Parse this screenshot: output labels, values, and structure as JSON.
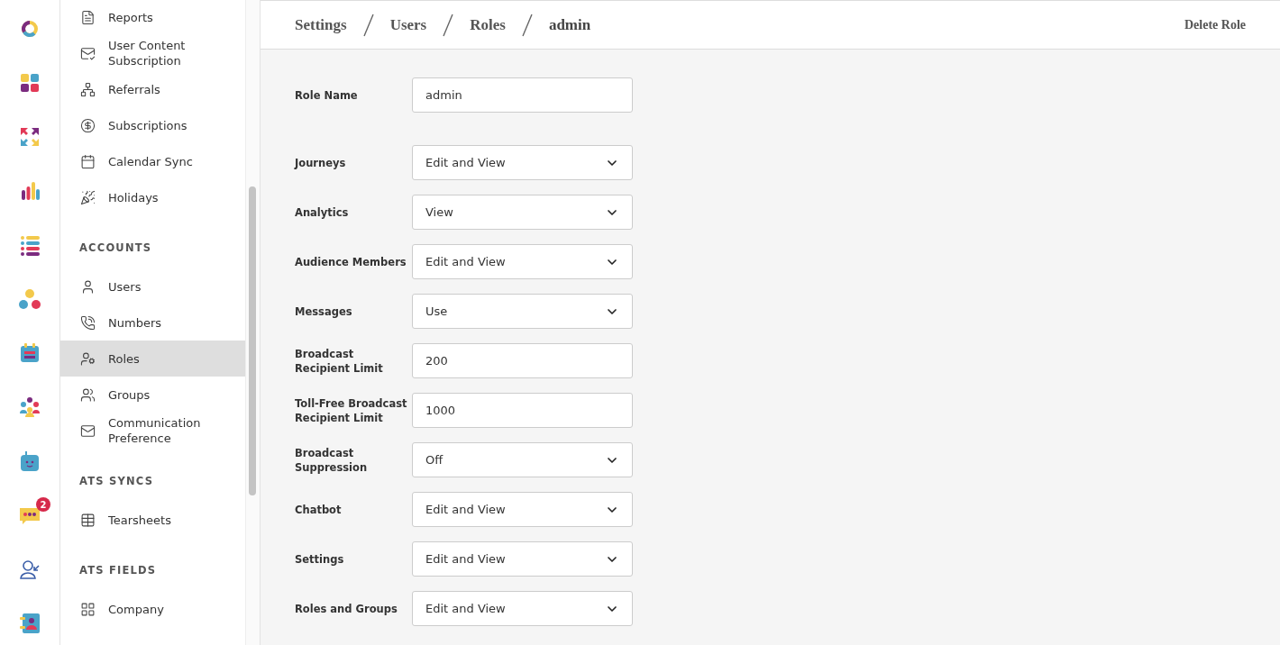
{
  "rail": {
    "badge": "2"
  },
  "sidebar": {
    "sections": [
      {
        "items": [
          {
            "label": "Reports",
            "selected": false
          },
          {
            "label": "User Content Subscription",
            "selected": false
          },
          {
            "label": "Referrals",
            "selected": false
          },
          {
            "label": "Subscriptions",
            "selected": false
          },
          {
            "label": "Calendar Sync",
            "selected": false
          },
          {
            "label": "Holidays",
            "selected": false
          }
        ]
      },
      {
        "heading": "ACCOUNTS",
        "items": [
          {
            "label": "Users",
            "selected": false
          },
          {
            "label": "Numbers",
            "selected": false
          },
          {
            "label": "Roles",
            "selected": true
          },
          {
            "label": "Groups",
            "selected": false
          },
          {
            "label": "Communication Preference",
            "selected": false
          }
        ]
      },
      {
        "heading": "ATS SYNCS",
        "items": [
          {
            "label": "Tearsheets",
            "selected": false
          }
        ]
      },
      {
        "heading": "ATS FIELDS",
        "items": [
          {
            "label": "Company",
            "selected": false
          }
        ]
      }
    ]
  },
  "breadcrumb": [
    "Settings",
    "Users",
    "Roles",
    "admin"
  ],
  "delete_button": "Delete Role",
  "form": [
    {
      "label": "Role Name",
      "kind": "text",
      "value": "admin"
    },
    {
      "label": "Journeys",
      "kind": "select",
      "value": "Edit and View"
    },
    {
      "label": "Analytics",
      "kind": "select",
      "value": "View"
    },
    {
      "label": "Audience Members",
      "kind": "select",
      "value": "Edit and View"
    },
    {
      "label": "Messages",
      "kind": "select",
      "value": "Use"
    },
    {
      "label": "Broadcast Recipient Limit",
      "kind": "text",
      "value": "200"
    },
    {
      "label": "Toll-Free Broadcast Recipient Limit",
      "kind": "text",
      "value": "1000"
    },
    {
      "label": "Broadcast Suppression",
      "kind": "select",
      "value": "Off"
    },
    {
      "label": "Chatbot",
      "kind": "select",
      "value": "Edit and View"
    },
    {
      "label": "Settings",
      "kind": "select",
      "value": "Edit and View"
    },
    {
      "label": "Roles and Groups",
      "kind": "select",
      "value": "Edit and View"
    }
  ]
}
